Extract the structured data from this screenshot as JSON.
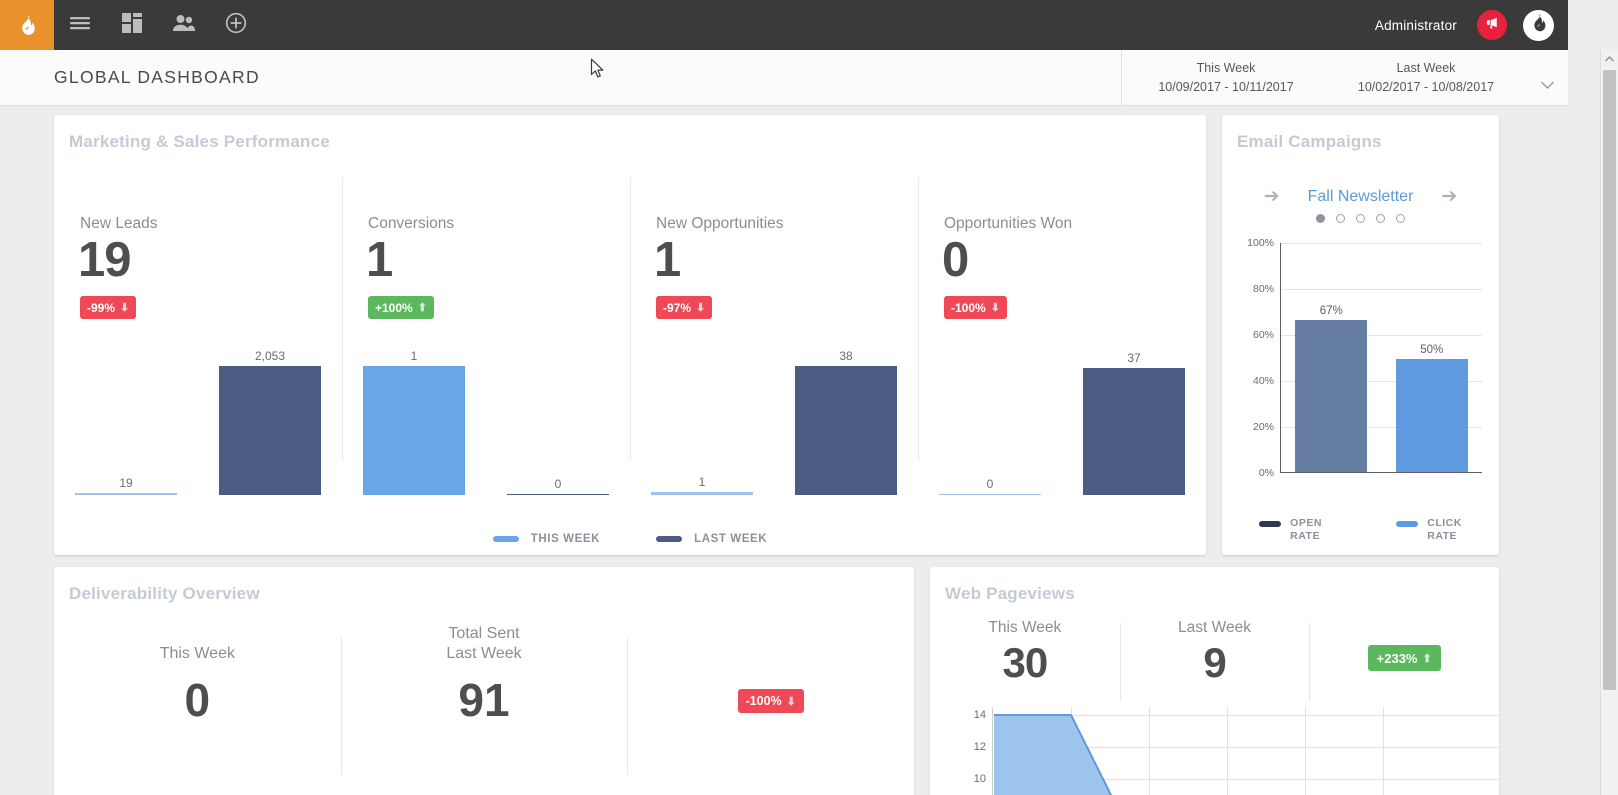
{
  "topnav": {
    "logo_icon": "flame-logo-icon",
    "items": [
      {
        "name": "menu-toggle",
        "icon": "hamburger-icon"
      },
      {
        "name": "dashboard",
        "icon": "grid-dashboard-icon"
      },
      {
        "name": "contacts",
        "icon": "people-icon"
      },
      {
        "name": "add",
        "icon": "plus-circle-icon"
      }
    ],
    "admin_label": "Administrator",
    "notification_icon": "megaphone-icon",
    "avatar_icon": "flame-avatar-icon"
  },
  "header": {
    "title": "GLOBAL DASHBOARD",
    "this_week_label": "This Week",
    "this_week_range": "10/09/2017 - 10/11/2017",
    "last_week_label": "Last Week",
    "last_week_range": "10/02/2017 - 10/08/2017",
    "caret_icon": "chevron-down-icon"
  },
  "colors": {
    "brand_orange": "#e8912d",
    "this_week_blue": "#6aa5e8",
    "last_week_navy": "#4c5b81",
    "negative_red": "#ef4957",
    "positive_green": "#5cb85c",
    "open_rate": "#667da3",
    "click_rate": "#5f9ae0"
  },
  "marketing": {
    "title": "Marketing & Sales Performance",
    "legend": [
      {
        "label": "THIS WEEK",
        "color": "#6aa5e8"
      },
      {
        "label": "LAST WEEK",
        "color": "#4c5b81"
      }
    ],
    "kpis": [
      {
        "label": "New Leads",
        "value": "19",
        "change": "-99%",
        "direction": "down",
        "this_week": "19",
        "last_week": "2,053"
      },
      {
        "label": "Conversions",
        "value": "1",
        "change": "+100%",
        "direction": "up",
        "this_week": "1",
        "last_week": "0"
      },
      {
        "label": "New Opportunities",
        "value": "1",
        "change": "-97%",
        "direction": "down",
        "this_week": "1",
        "last_week": "38"
      },
      {
        "label": "Opportunities Won",
        "value": "0",
        "change": "-100%",
        "direction": "down",
        "this_week": "0",
        "last_week": "37"
      }
    ]
  },
  "email": {
    "title": "Email Campaigns",
    "campaign_name": "Fall Newsletter",
    "prev_icon": "arrow-left-icon",
    "next_icon": "arrow-right-icon",
    "dot_count": 5,
    "active_dot": 0,
    "legend": [
      {
        "line1": "OPEN",
        "line2": "RATE",
        "color": "#667da3"
      },
      {
        "line1": "CLICK",
        "line2": "RATE",
        "color": "#5f9ae0"
      }
    ]
  },
  "deliverability": {
    "title": "Deliverability Overview",
    "total_sent_label": "Total Sent",
    "this_week_label": "This Week",
    "this_week_value": "0",
    "last_week_label": "Last Week",
    "last_week_value": "91",
    "change": "-100%",
    "change_direction": "down"
  },
  "webviews": {
    "title": "Web Pageviews",
    "this_week_label": "This Week",
    "this_week_value": "30",
    "last_week_label": "Last Week",
    "last_week_value": "9",
    "change": "+233%",
    "change_direction": "up"
  },
  "chart_data": [
    {
      "type": "bar",
      "title": "Marketing & Sales Performance",
      "categories": [
        "New Leads",
        "Conversions",
        "New Opportunities",
        "Opportunities Won"
      ],
      "series": [
        {
          "name": "THIS WEEK",
          "color": "#6aa5e8",
          "values": [
            19,
            1,
            1,
            0
          ]
        },
        {
          "name": "LAST WEEK",
          "color": "#4c5b81",
          "values": [
            2053,
            0,
            38,
            37
          ]
        }
      ],
      "legend_position": "bottom",
      "grid": false
    },
    {
      "type": "bar",
      "title": "Email Campaigns",
      "subtitle": "Fall Newsletter",
      "categories": [
        "OPEN RATE",
        "CLICK RATE"
      ],
      "values": [
        67,
        50
      ],
      "value_labels": [
        "67%",
        "50%"
      ],
      "colors": [
        "#667da3",
        "#5f9ae0"
      ],
      "ylabel": "",
      "ylim": [
        0,
        100
      ],
      "yticks": [
        0,
        20,
        40,
        60,
        80,
        100
      ],
      "ytick_labels": [
        "0%",
        "20%",
        "40%",
        "60%",
        "80%",
        "100%"
      ],
      "legend_position": "bottom",
      "grid": true
    },
    {
      "type": "area",
      "title": "Web Pageviews",
      "yticks": [
        10,
        12,
        14
      ],
      "ytick_labels": [
        "10",
        "12",
        "14"
      ],
      "ylim": [
        10,
        14
      ],
      "values": [
        14,
        14,
        10
      ],
      "color": "#6aa5e8",
      "grid": true,
      "note": "partially visible below fold"
    }
  ],
  "scrollbar": {
    "up_icon": "scroll-up-arrow-icon"
  }
}
